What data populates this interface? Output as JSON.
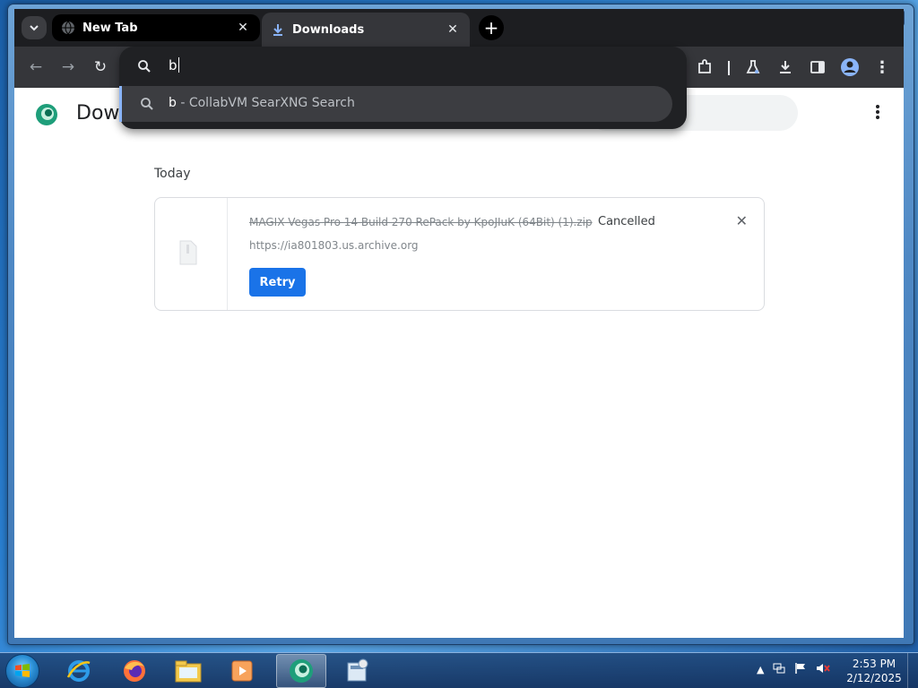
{
  "window": {
    "min_label": "—",
    "max_label": "☐",
    "close_label": "✕"
  },
  "tabs": [
    {
      "title": "New Tab",
      "icon": "globe-icon",
      "close": "✕"
    },
    {
      "title": "Downloads",
      "icon": "download-icon",
      "close": "✕"
    }
  ],
  "tab_search_icon": "chevron-down-icon",
  "new_tab_label": "+",
  "toolbar": {
    "back": "←",
    "forward": "→",
    "reload": "↻"
  },
  "omnibox": {
    "input_value": "b",
    "suggestion_query": "b",
    "suggestion_rest": " - CollabVM SearXNG Search"
  },
  "page": {
    "title": "Dow",
    "date_group": "Today",
    "menu_label": "⋮"
  },
  "download": {
    "file_name": "MAGIX Vegas Pro 14 Build 270 RePack by KpoJIuK (64Bit) (1).zip",
    "status": "Cancelled",
    "url": "https://ia801803.us.archive.org",
    "retry_label": "Retry",
    "remove_label": "✕"
  },
  "taskbar": {
    "time": "2:53 PM",
    "date": "2/12/2025",
    "apps": [
      "internet-explorer-icon",
      "firefox-icon",
      "file-explorer-icon",
      "media-player-icon",
      "browser-icon",
      "calculator-icon"
    ]
  },
  "colors": {
    "accent": "#1a73e8",
    "chrome_dark": "#35363a",
    "omnibox_bg": "#202124"
  }
}
